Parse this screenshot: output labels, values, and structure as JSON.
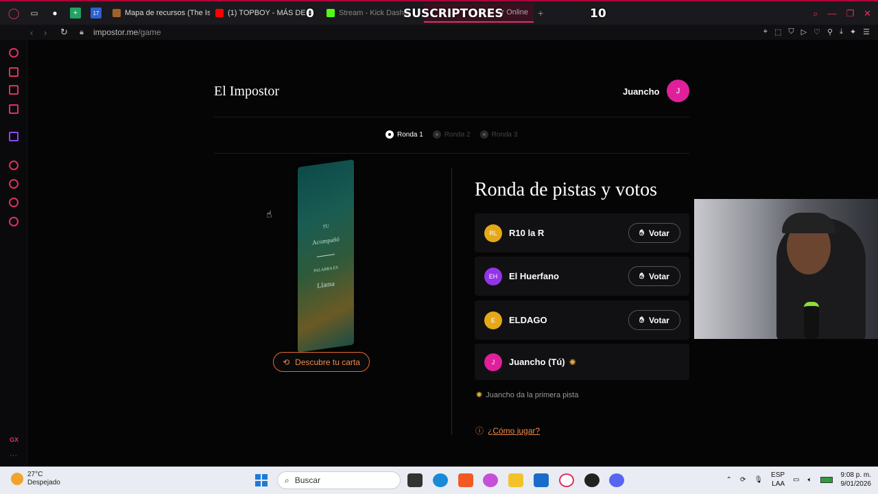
{
  "browser": {
    "tabs": [
      {
        "label": "Mapa de recursos (The Isl",
        "favicon_color": "#a0622a"
      },
      {
        "label": "(1) TOPBOY - MÁS DE A",
        "favicon_color": "#ff0000"
      },
      {
        "label": "Stream - Kick Dashb",
        "favicon_color": "#53fc18"
      },
      {
        "label": "r Online",
        "favicon_color": "#e0315f"
      }
    ],
    "overlay": {
      "left_count": "0",
      "label": "SUSCRIPTORES",
      "right_count": "10"
    },
    "url_host": "impostor.me",
    "url_path": "/game",
    "new_tab": "+"
  },
  "app": {
    "title": "El Impostor",
    "user": {
      "name": "Juancho",
      "initial": "J"
    },
    "rounds": [
      {
        "label": "Ronda 1",
        "active": true
      },
      {
        "label": "Ronda 2",
        "active": false
      },
      {
        "label": "Ronda 3",
        "active": false
      }
    ],
    "card": {
      "line1": "TU",
      "line2": "Acompañó",
      "line3": "PALABRA ES",
      "line4": "Llama"
    },
    "reveal_button": "Descubre tu carta",
    "section_title": "Ronda de pistas y votos",
    "players": [
      {
        "initials": "RL",
        "name": "R10 la R",
        "color": "#e6a817",
        "vote": "Votar"
      },
      {
        "initials": "EH",
        "name": "El Huerfano",
        "color": "#9333ea",
        "vote": "Votar"
      },
      {
        "initials": "E",
        "name": "ELDAGO",
        "color": "#e6a817",
        "vote": "Votar"
      },
      {
        "initials": "J",
        "name": "Juancho (Tú)",
        "color": "#e0209a"
      }
    ],
    "hint": "Juancho da la primera pista",
    "howto": "¿Cómo jugar?"
  },
  "taskbar": {
    "weather_temp": "27°C",
    "weather_desc": "Despejado",
    "search_placeholder": "Buscar",
    "lang1": "ESP",
    "lang2": "LAA",
    "time": "9:08 p. m.",
    "date": "9/01/2026"
  },
  "colors": {
    "accent": "#e0315f",
    "orange": "#f08a4a",
    "brand_pink": "#e0209a"
  }
}
